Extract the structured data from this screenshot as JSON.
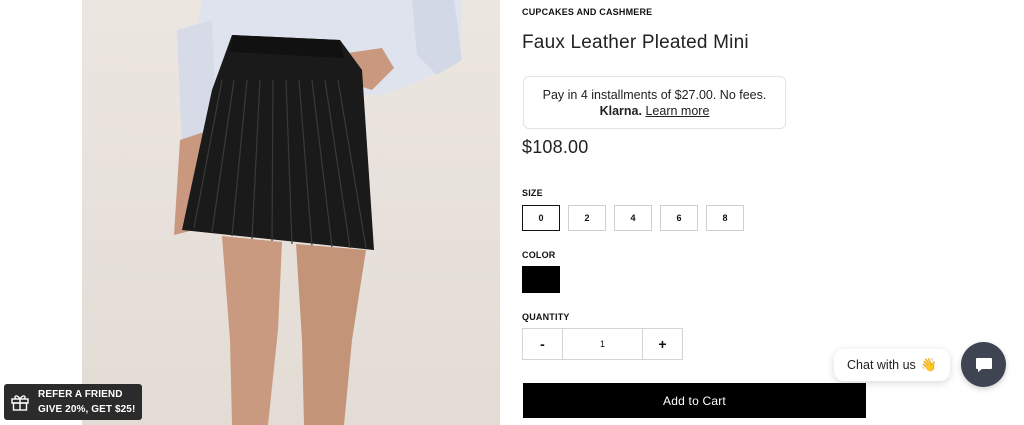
{
  "product": {
    "brand": "CUPCAKES AND CASHMERE",
    "title": "Faux Leather Pleated Mini",
    "price": "$108.00"
  },
  "klarna": {
    "line1": "Pay in 4 installments of $27.00. No fees.",
    "logo": "Klarna.",
    "link": "Learn more"
  },
  "size": {
    "label": "SIZE",
    "options": [
      "0",
      "2",
      "4",
      "6",
      "8"
    ],
    "selected": "0"
  },
  "color": {
    "label": "COLOR",
    "swatch": "#000000"
  },
  "quantity": {
    "label": "QUANTITY",
    "minus": "-",
    "value": "1",
    "plus": "+"
  },
  "cart": {
    "label": "Add to Cart"
  },
  "refer": {
    "line1": "REFER A FRIEND",
    "line2": "GIVE 20%, GET $25!",
    "icon": "gift-icon"
  },
  "chat": {
    "label": "Chat with us",
    "emoji": "👋",
    "icon": "chat-bubble-icon"
  }
}
